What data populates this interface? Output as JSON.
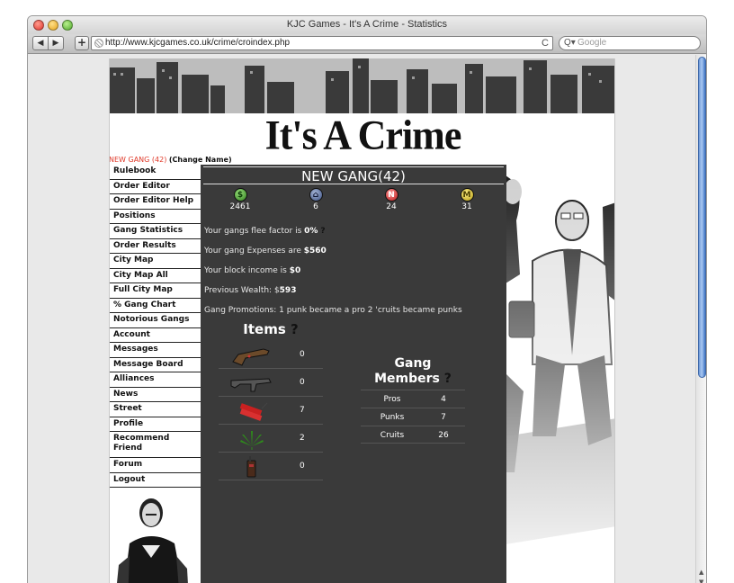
{
  "window": {
    "title": "KJC Games - It's A Crime - Statistics"
  },
  "toolbar": {
    "back_label": "◀",
    "forward_label": "▶",
    "add_label": "+",
    "url": "http://www.kjcgames.co.uk/crime/croindex.php",
    "reload_label": "C",
    "search_placeholder": "Google",
    "search_icon": "Q▾"
  },
  "site": {
    "title": "It's A Crime"
  },
  "gang_line": {
    "name": "NEW GANG (42)",
    "change": "(Change Name)"
  },
  "sidebar": {
    "items": [
      "Rulebook",
      "Order Editor",
      "Order Editor Help",
      "Positions",
      "Gang Statistics",
      "Order Results",
      "City Map",
      "City Map All",
      "Full City Map",
      "% Gang Chart",
      "Notorious Gangs",
      "Account",
      "Messages",
      "Message Board",
      "Alliances",
      "News",
      "Street",
      "Profile",
      "Recommend Friend",
      "Forum",
      "Logout"
    ]
  },
  "panel": {
    "title": "NEW GANG(42)",
    "stats": [
      {
        "icon": "cash-icon",
        "glyph": "$",
        "value": "2461"
      },
      {
        "icon": "turf-icon",
        "glyph": "⌂",
        "value": "6"
      },
      {
        "icon": "notoriety-icon",
        "glyph": "N",
        "value": "24"
      },
      {
        "icon": "muscle-icon",
        "glyph": "M",
        "value": "31"
      }
    ],
    "flee": {
      "prefix": "Your gangs flee factor is ",
      "value": "0%",
      "help": "?"
    },
    "expenses": {
      "prefix": "Your gang Expenses are ",
      "value": "$560"
    },
    "income": {
      "prefix": "Your block income is ",
      "value": "$0"
    },
    "wealth": {
      "prefix": "Previous Wealth: $",
      "value": "593"
    },
    "promotions": "Gang Promotions: 1 punk became a pro 2 'cruits became punks",
    "items_title": "Items",
    "items_help": "?",
    "items": [
      {
        "icon": "pistol-icon",
        "count": "0"
      },
      {
        "icon": "machine-gun-icon",
        "count": "0"
      },
      {
        "icon": "dynamite-icon",
        "count": "7"
      },
      {
        "icon": "marijuana-leaf-icon",
        "count": "2"
      },
      {
        "icon": "walkie-talkie-icon",
        "count": "0"
      }
    ],
    "members_title_1": "Gang",
    "members_title_2": "Members",
    "members_help": "?",
    "members": [
      {
        "label": "Pros",
        "value": "4"
      },
      {
        "label": "Punks",
        "value": "7"
      },
      {
        "label": "Cruits",
        "value": "26"
      }
    ]
  }
}
